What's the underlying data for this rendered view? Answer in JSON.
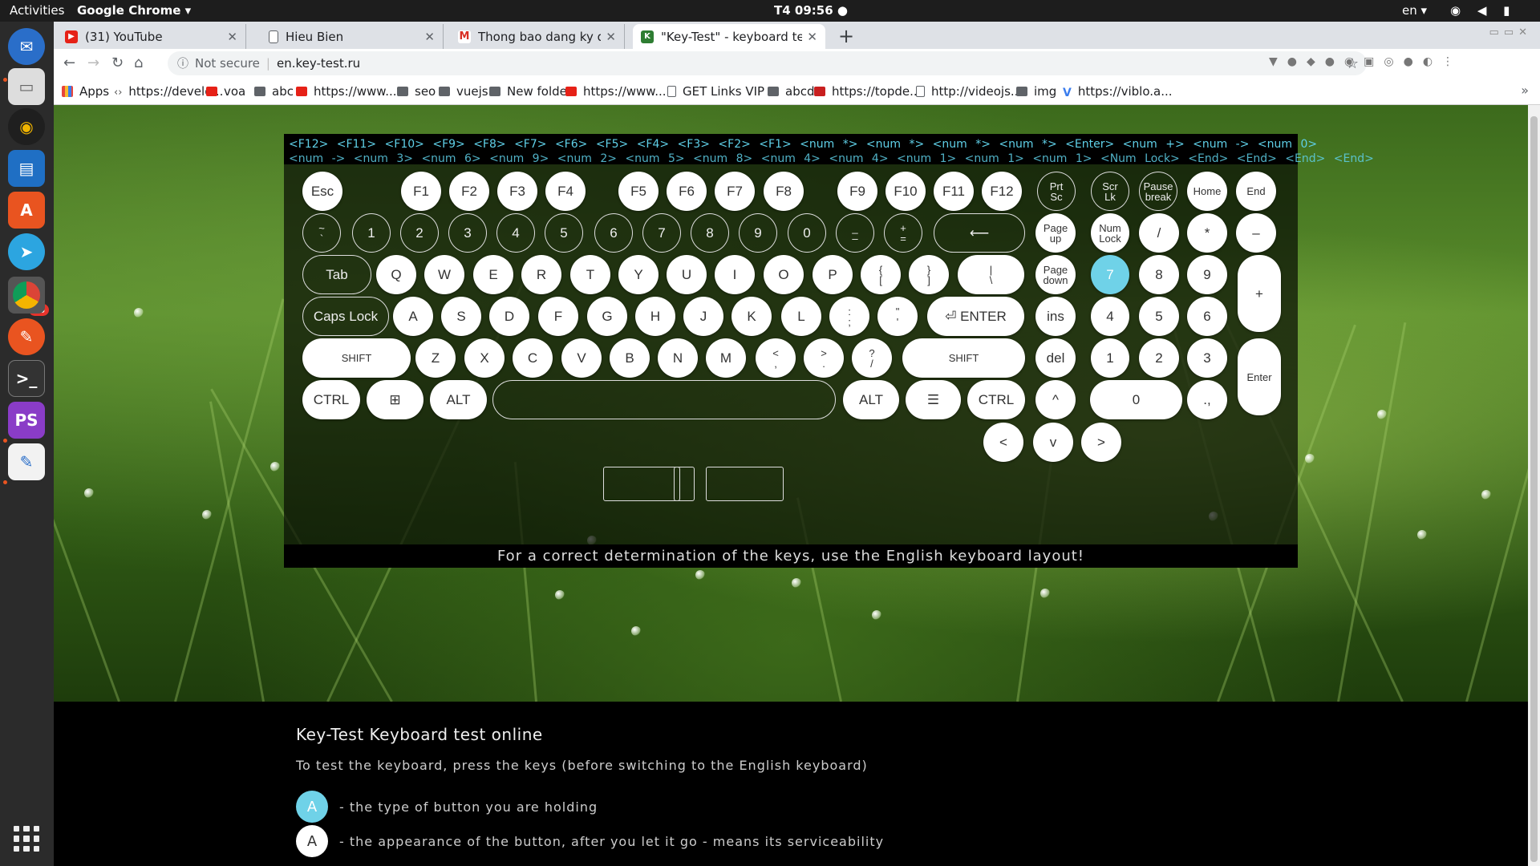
{
  "topbar": {
    "activities": "Activities",
    "app": "Google Chrome ▾",
    "clock": "T4 09:56 ●",
    "lang": "en ▾",
    "tray": "◉ ◀ ▮"
  },
  "dock": {
    "badge": "63"
  },
  "tabs": [
    {
      "title": "(31) YouTube",
      "icon": "youtube-icon",
      "color": "#e62117"
    },
    {
      "title": "Hieu Bien",
      "icon": "page-icon",
      "color": "#ffffff"
    },
    {
      "title": "Thong bao dang ky dich v",
      "icon": "gmail-icon",
      "color": "#d93025"
    },
    {
      "title": "\"Key-Test\" - keyboard test",
      "icon": "keytest-icon",
      "color": "#2e7d32"
    }
  ],
  "omnibox": {
    "secure": "Not secure",
    "url": "en.key-test.ru"
  },
  "bookmarks": [
    {
      "label": "Apps",
      "icon": "apps"
    },
    {
      "label": "https://develo...",
      "icon": "code"
    },
    {
      "label": "voa",
      "icon": "yt"
    },
    {
      "label": "abc",
      "icon": "folder"
    },
    {
      "label": "https://www....",
      "icon": "yt"
    },
    {
      "label": "seo",
      "icon": "folder"
    },
    {
      "label": "vuejs",
      "icon": "folder"
    },
    {
      "label": "New folder",
      "icon": "folder"
    },
    {
      "label": "https://www....",
      "icon": "yt"
    },
    {
      "label": "GET Links VIP ...",
      "icon": "page"
    },
    {
      "label": "abcd",
      "icon": "folder"
    },
    {
      "label": "https://topde...",
      "icon": "topdev"
    },
    {
      "label": "http://videojs....",
      "icon": "page"
    },
    {
      "label": "img",
      "icon": "folder"
    },
    {
      "label": "https://viblo.a...",
      "icon": "v"
    }
  ],
  "keyboard": {
    "log_line1": "<F12> <F11> <F10> <F9> <F8> <F7> <F6> <F5> <F4> <F3> <F2> <F1> <num *> <num *> <num *> <num *> <Enter> <num +> <num -> <num 0>",
    "log_line2": "<num -> <num 3> <num 6> <num 9> <num 2> <num 5> <num 8> <num 4> <num 4> <num 1> <num 1> <num 1> <Num Lock> <End> <End> <End> <End>",
    "note": "For a correct determination of the keys, use the English keyboard layout!",
    "keys": {
      "esc": "Esc",
      "f1": "F1",
      "f2": "F2",
      "f3": "F3",
      "f4": "F4",
      "f5": "F5",
      "f6": "F6",
      "f7": "F7",
      "f8": "F8",
      "f9": "F9",
      "f10": "F10",
      "f11": "F11",
      "f12": "F12",
      "prtsc": "Prt\nSc",
      "scrlk": "Scr\nLk",
      "pause": "Pause\nbreak",
      "home": "Home",
      "end": "End",
      "tilde": "~\n`",
      "n1": "1",
      "n2": "2",
      "n3": "3",
      "n4": "4",
      "n5": "5",
      "n6": "6",
      "n7": "7",
      "n8": "8",
      "n9": "9",
      "n0": "0",
      "minus": "_\n–",
      "equal": "+\n=",
      "backspace": "⟵",
      "pgup": "Page\nup",
      "numlock": "Num\nLock",
      "np_div": "/",
      "np_mul": "*",
      "np_sub": "–",
      "tab": "Tab",
      "q": "Q",
      "w": "W",
      "e": "E",
      "r": "R",
      "t": "T",
      "y": "Y",
      "u": "U",
      "i": "I",
      "o": "O",
      "p": "P",
      "lbrace": "{\n[",
      "rbrace": "}\n]",
      "bslash": "|\n\\",
      "pgdn": "Page\ndown",
      "np7": "7",
      "np8": "8",
      "np9": "9",
      "np_add": "+",
      "caps": "Caps Lock",
      "a": "A",
      "s": "S",
      "d": "D",
      "f": "F",
      "g": "G",
      "h": "H",
      "j": "J",
      "k": "K",
      "l": "L",
      "semi": ":\n;",
      "quote": "\"\n'",
      "enter": "⏎ ENTER",
      "ins": "ins",
      "np4": "4",
      "np5": "5",
      "np6": "6",
      "lshift": "SHIFT",
      "z": "Z",
      "x": "X",
      "c": "C",
      "v": "V",
      "b": "B",
      "n": "N",
      "m": "M",
      "comma": "<\n,",
      "period": ">\n.",
      "slash": "?\n/",
      "rshift": "SHIFT",
      "del": "del",
      "np1": "1",
      "np2": "2",
      "np3": "3",
      "np_enter": "Enter",
      "lctrl": "CTRL",
      "win": "⊞",
      "lalt": "ALT",
      "space": "",
      "ralt": "ALT",
      "menu": "☰",
      "rctrl": "CTRL",
      "up": "^",
      "np0": "0",
      "np_dot": ".,",
      "left": "<",
      "down": "v",
      "right": ">"
    }
  },
  "description": {
    "title": "Key-Test Keyboard test online",
    "text": "To test the keyboard, press the keys (before switching to the English keyboard)",
    "legend": [
      {
        "key": "A",
        "text": "- the type of button you are holding"
      },
      {
        "key": "A",
        "text": "- the appearance of the button, after you let it go - means its serviceability"
      }
    ]
  },
  "colors": {
    "active_key": "#6fd2e8",
    "page_bg": "#000000"
  }
}
